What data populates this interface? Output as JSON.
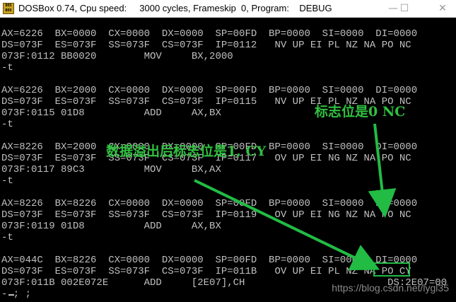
{
  "window": {
    "icon_text": "DOS BOX",
    "title": "DOSBox 0.74, Cpu speed:     3000 cycles, Frameskip  0, Program:    DEBUG",
    "minimize_glyph": "—",
    "maximize_glyph": "☐",
    "close_glyph": "✕"
  },
  "console_lines": [
    "AX=6226  BX=0000  CX=0000  DX=0000  SP=00FD  BP=0000  SI=0000  DI=0000",
    "DS=073F  ES=073F  SS=073F  CS=073F  IP=0112   NV UP EI PL NZ NA PO NC",
    "073F:0112 BB0020        MOV     BX,2000",
    "-t",
    "",
    "AX=6226  BX=2000  CX=0000  DX=0000  SP=00FD  BP=0000  SI=0000  DI=0000",
    "DS=073F  ES=073F  SS=073F  CS=073F  IP=0115   NV UP EI PL NZ NA PO NC",
    "073F:0115 01D8          ADD     AX,BX",
    "-t",
    "",
    "AX=8226  BX=2000  CX=0000  DX=0000  SP=00FD  BP=0000  SI=0000  DI=0000",
    "DS=073F  ES=073F  SS=073F  CS=073F  IP=0117   OV UP EI NG NZ NA PO NC",
    "073F:0117 89C3          MOV     BX,AX",
    "-t",
    "",
    "AX=8226  BX=8226  CX=0000  DX=0000  SP=00FD  BP=0000  SI=0000  DI=0000",
    "DS=073F  ES=073F  SS=073F  CS=073F  IP=0119   OV UP EI NG NZ NA PO NC",
    "073F:0119 01D8          ADD     AX,BX",
    "-t",
    "",
    "AX=044C  BX=8226  CX=0000  DX=0000  SP=00FD  BP=0000  SI=0000  DI=0000",
    "DS=073F  ES=073F  SS=073F  CS=073F  IP=011B   OV UP EI PL NZ NA PO CY",
    "073F:011B 002E072E      ADD     [2E07],CH                        DS:2E07=00",
    "- ; ;"
  ],
  "annotations": {
    "nc_label": "标志位是0 NC",
    "cy_label": "数据溢出后标志位是1, CY",
    "accent_color": "#30c040"
  },
  "watermark": "https://blog.csdn.net/lygl35"
}
